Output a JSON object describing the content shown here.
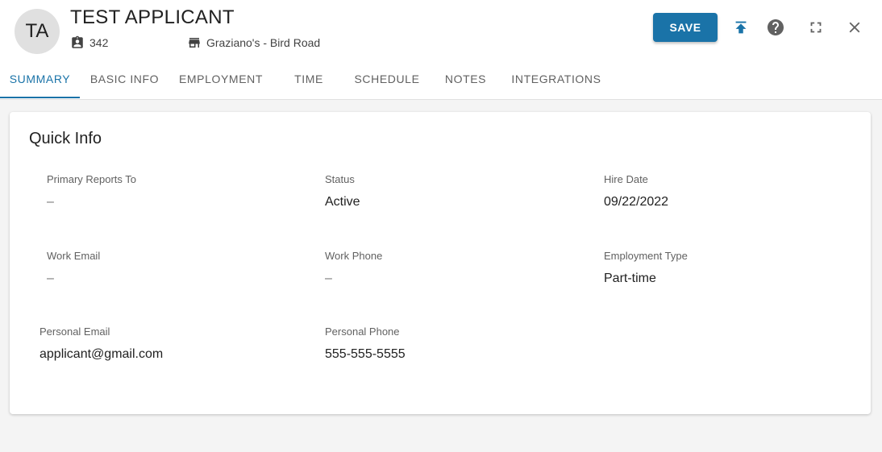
{
  "header": {
    "avatar_initials": "TA",
    "name": "TEST APPLICANT",
    "employee_id": "342",
    "location": "Graziano's - Bird Road",
    "save_label": "SAVE"
  },
  "tabs": [
    {
      "label": "SUMMARY",
      "active": true
    },
    {
      "label": "BASIC INFO",
      "active": false
    },
    {
      "label": "EMPLOYMENT",
      "active": false
    },
    {
      "label": "TIME",
      "active": false
    },
    {
      "label": "SCHEDULE",
      "active": false
    },
    {
      "label": "NOTES",
      "active": false
    },
    {
      "label": "INTEGRATIONS",
      "active": false
    }
  ],
  "quick_info": {
    "title": "Quick Info",
    "primary_reports_to": {
      "label": "Primary Reports To",
      "value": "–"
    },
    "status": {
      "label": "Status",
      "value": "Active"
    },
    "hire_date": {
      "label": "Hire Date",
      "value": "09/22/2022"
    },
    "work_email": {
      "label": "Work Email",
      "value": "–"
    },
    "work_phone": {
      "label": "Work Phone",
      "value": "–"
    },
    "employment_type": {
      "label": "Employment Type",
      "value": "Part-time"
    },
    "personal_email": {
      "label": "Personal Email",
      "value": "applicant@gmail.com"
    },
    "personal_phone": {
      "label": "Personal Phone",
      "value": "555-555-5555"
    }
  },
  "icons": {
    "id_badge": "contact-badge-icon",
    "store": "store-icon",
    "upload": "upload-icon",
    "help": "help-icon",
    "fullscreen": "fullscreen-icon",
    "close": "close-icon"
  },
  "colors": {
    "accent": "#1a73a8",
    "background": "#f4f4f4",
    "card": "#ffffff"
  }
}
